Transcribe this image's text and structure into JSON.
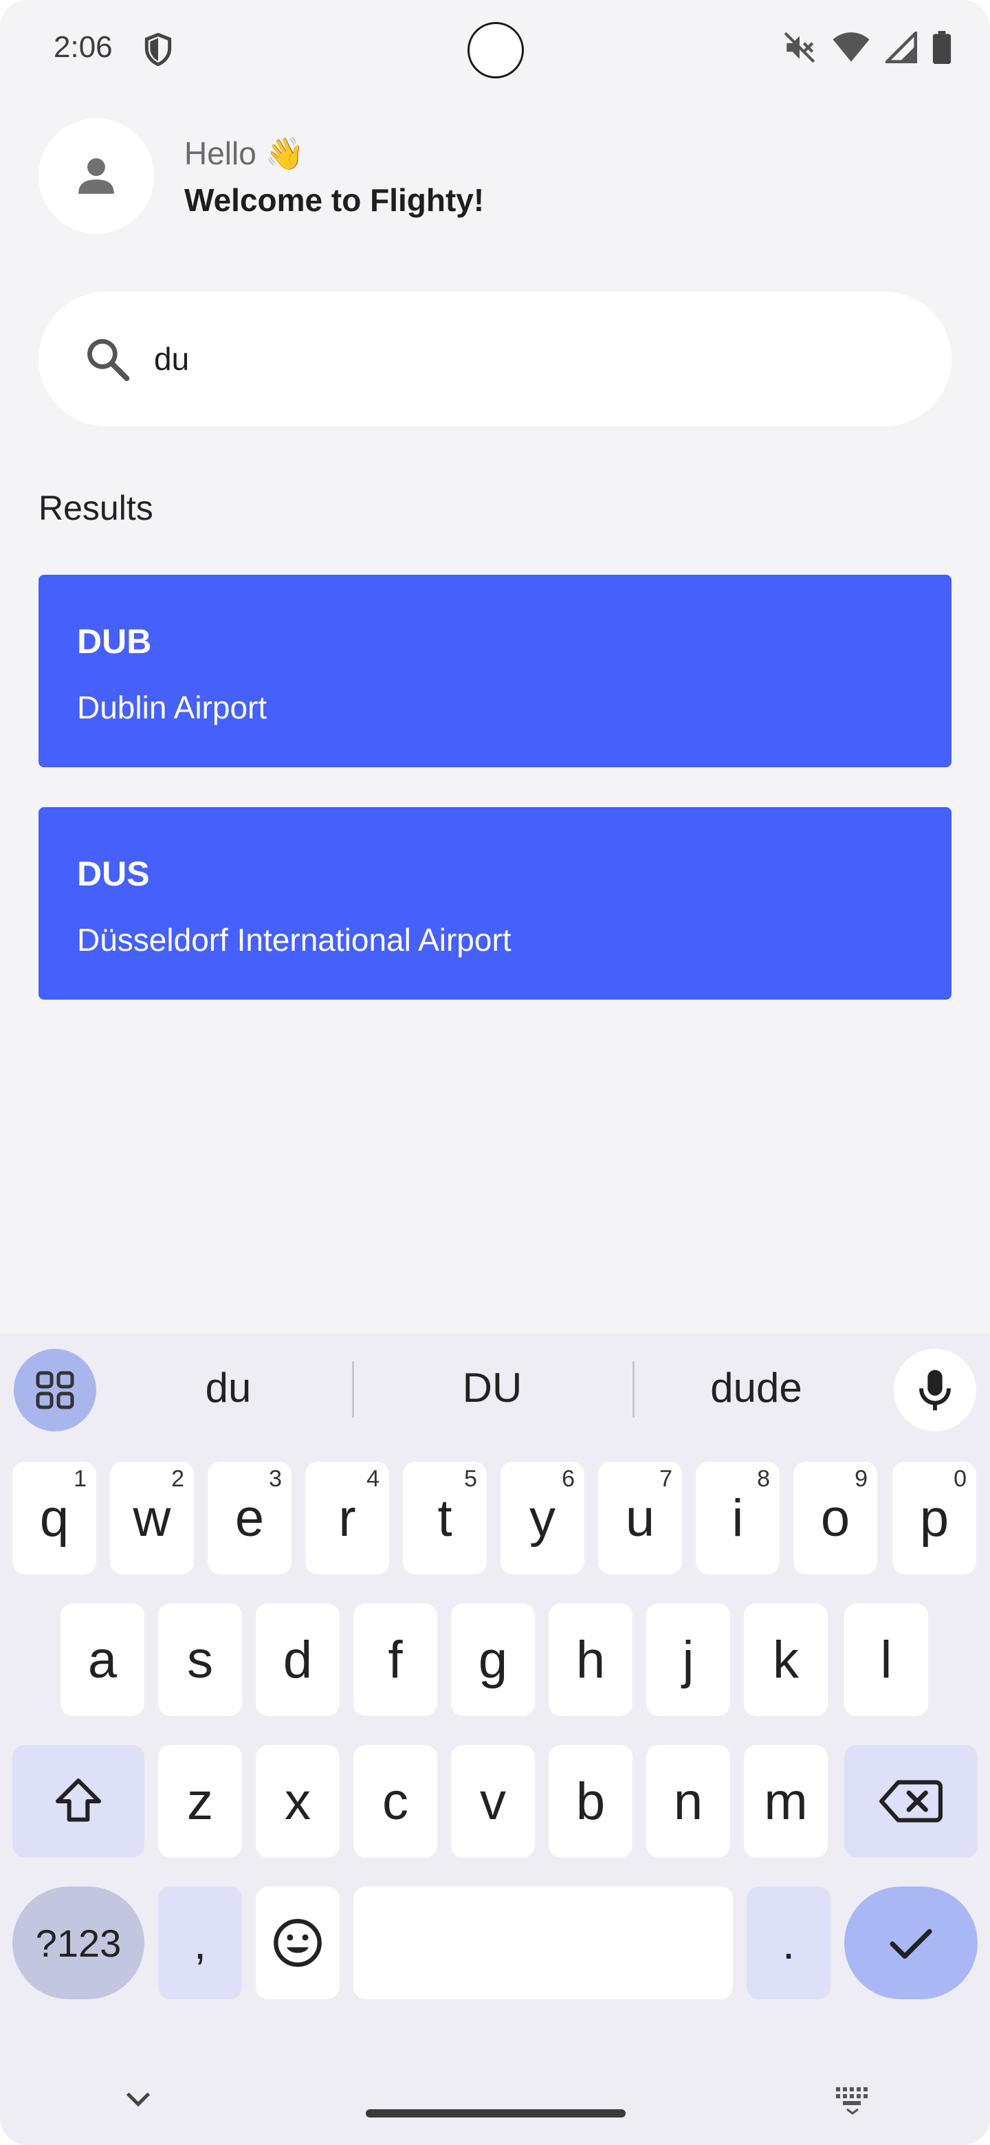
{
  "status_bar": {
    "time": "2:06"
  },
  "header": {
    "greeting": "Hello 👋",
    "welcome": "Welcome to Flighty!"
  },
  "search": {
    "value": "du"
  },
  "results": {
    "title": "Results",
    "items": [
      {
        "code": "DUB",
        "name": "Dublin Airport"
      },
      {
        "code": "DUS",
        "name": "Düsseldorf International Airport"
      }
    ]
  },
  "colors": {
    "card_background": "#4560fb",
    "screen_background": "#f4f3f5",
    "keyboard_background": "#efedf4"
  },
  "keyboard": {
    "suggestions": [
      "du",
      "DU",
      "dude"
    ],
    "row1": [
      {
        "label": "q",
        "hint": "1"
      },
      {
        "label": "w",
        "hint": "2"
      },
      {
        "label": "e",
        "hint": "3"
      },
      {
        "label": "r",
        "hint": "4"
      },
      {
        "label": "t",
        "hint": "5"
      },
      {
        "label": "y",
        "hint": "6"
      },
      {
        "label": "u",
        "hint": "7"
      },
      {
        "label": "i",
        "hint": "8"
      },
      {
        "label": "o",
        "hint": "9"
      },
      {
        "label": "p",
        "hint": "0"
      }
    ],
    "row2": [
      "a",
      "s",
      "d",
      "f",
      "g",
      "h",
      "j",
      "k",
      "l"
    ],
    "row3": [
      "z",
      "x",
      "c",
      "v",
      "b",
      "n",
      "m"
    ],
    "symbols_label": "?123",
    "comma_label": ",",
    "period_label": "."
  }
}
